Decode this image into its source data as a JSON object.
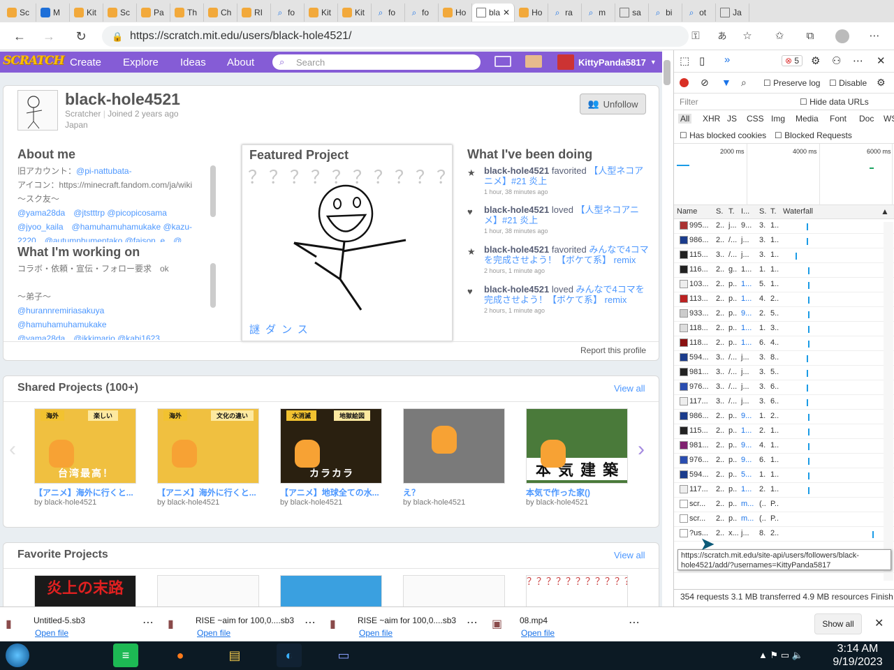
{
  "tabs": [
    {
      "fav": "scratch",
      "label": "Sc"
    },
    {
      "fav": "outlook",
      "label": "M"
    },
    {
      "fav": "scratch",
      "label": "Kit"
    },
    {
      "fav": "scratch",
      "label": "Sc"
    },
    {
      "fav": "scratch",
      "label": "Pa"
    },
    {
      "fav": "scratch",
      "label": "Th"
    },
    {
      "fav": "scratch",
      "label": "Ch"
    },
    {
      "fav": "scratch",
      "label": "RI"
    },
    {
      "fav": "search",
      "label": "fo"
    },
    {
      "fav": "scratch",
      "label": "Kit"
    },
    {
      "fav": "scratch",
      "label": "Kit"
    },
    {
      "fav": "search",
      "label": "fo"
    },
    {
      "fav": "search",
      "label": "fo"
    },
    {
      "fav": "scratch",
      "label": "Ho"
    },
    {
      "fav": "active",
      "label": "bla"
    },
    {
      "fav": "scratch",
      "label": "Ho"
    },
    {
      "fav": "search",
      "label": "ra"
    },
    {
      "fav": "search",
      "label": "m"
    },
    {
      "fav": "doc",
      "label": "sa"
    },
    {
      "fav": "search",
      "label": "bi"
    },
    {
      "fav": "search",
      "label": "ot"
    },
    {
      "fav": "doc",
      "label": "Ja"
    }
  ],
  "browser": {
    "url": "https://scratch.mit.edu/users/black-hole4521/"
  },
  "scratch_nav": {
    "logo": "SCRATCH",
    "links": [
      "Create",
      "Explore",
      "Ideas",
      "About"
    ],
    "search_placeholder": "Search",
    "username": "KittyPanda5817"
  },
  "profile": {
    "username": "black-hole4521",
    "role": "Scratcher",
    "joined": "Joined 2 years ago",
    "country": "Japan",
    "unfollow_label": "Unfollow",
    "about_heading": "About me",
    "about_lines": [
      {
        "t": "旧アカウント：",
        "l": "@pi-nattubata-"
      },
      {
        "t": "アイコン：https://minecraft.fandom.com/ja/wiki",
        "l": ""
      },
      {
        "t": "～スク友～",
        "l": ""
      },
      {
        "t": "",
        "l": "@yama28da　@jtstttrp @picopicosama"
      },
      {
        "t": "",
        "l": "@jyoo_kaila　@hamuhamuhamukake @kazu-"
      },
      {
        "t": "",
        "l": "2220　@autumnhumentako @faison_e　@"
      }
    ],
    "working_heading": "What I'm working on",
    "working_lines": [
      {
        "t": "コラボ・依頼・宣伝・フォロー要求　ok",
        "l": ""
      },
      {
        "t": "",
        "l": ""
      },
      {
        "t": "～弟子～",
        "l": ""
      },
      {
        "t": "",
        "l": "@hurannremiriasakuya"
      },
      {
        "t": "",
        "l": "@hamuhamuhamukake"
      },
      {
        "t": "",
        "l": "@yama28da　@ikkimario @kabi1623"
      }
    ],
    "featured_heading": "Featured Project",
    "featured_title": "謎ダンス",
    "activity_heading": "What I've been doing",
    "activity": [
      {
        "icon": "star",
        "user": "black-hole4521",
        "action": "favorited",
        "target": "【人型ネコアニメ】#21 炎上",
        "time": "1 hour, 38 minutes ago"
      },
      {
        "icon": "heart",
        "user": "black-hole4521",
        "action": "loved",
        "target": "【人型ネコアニメ】#21 炎上",
        "time": "1 hour, 38 minutes ago"
      },
      {
        "icon": "star",
        "user": "black-hole4521",
        "action": "favorited",
        "target": "みんなで4コマを完成させよう！【ボケて系】 remix",
        "time": "2 hours, 1 minute ago"
      },
      {
        "icon": "heart",
        "user": "black-hole4521",
        "action": "loved",
        "target": "みんなで4コマを完成させよう！【ボケて系】 remix",
        "time": "2 hours, 1 minute ago"
      }
    ],
    "report": "Report this profile"
  },
  "shared": {
    "heading": "Shared Projects (100+)",
    "view_all": "View all",
    "projects": [
      {
        "title": "【アニメ】海外に行くと...",
        "by": "by black-hole4521",
        "bg": "#f0c040",
        "labels": [
          "海外",
          "楽しい"
        ],
        "caption": "台湾最高！"
      },
      {
        "title": "【アニメ】海外に行くと...",
        "by": "by black-hole4521",
        "bg": "#f0c040",
        "labels": [
          "海外",
          "文化の違い"
        ],
        "caption": ""
      },
      {
        "title": "【アニメ】地球全ての水...",
        "by": "by black-hole4521",
        "bg": "#2a2010",
        "labels": [
          "水消滅",
          "地獄絵図"
        ],
        "caption": "カラカラ"
      },
      {
        "title": "え？",
        "by": "by black-hole4521",
        "bg": "#7a7a7a",
        "labels": [],
        "caption": ""
      },
      {
        "title": "本気で作った家()",
        "by": "by black-hole4521",
        "bg": "#4a7a3a",
        "labels": [],
        "caption": "本 気 建 築"
      }
    ]
  },
  "favorites": {
    "heading": "Favorite Projects",
    "view_all": "View all",
    "first_caption": "炎上の末路"
  },
  "devtools": {
    "error_count": "5",
    "preserve_log": "Preserve log",
    "disable": "Disable",
    "filter_placeholder": "Filter",
    "hide_data_urls": "Hide data URLs",
    "types": [
      "All",
      "XHR",
      "JS",
      "CSS",
      "Img",
      "Media",
      "Font",
      "Doc",
      "WS",
      "Manif"
    ],
    "has_blocked": "Has blocked cookies",
    "blocked_requests": "Blocked Requests",
    "timeline": [
      "2000 ms",
      "4000 ms",
      "6000 ms"
    ],
    "cols": [
      "Name",
      "S.",
      "T.",
      "I...",
      "S.",
      "T.",
      "Waterfall"
    ],
    "rows": [
      {
        "n": "995...",
        "s": "2..",
        "t": "j...",
        "i": "9...",
        "z": "3.",
        "m": "1..",
        "ic": "#a33"
      },
      {
        "n": "986...",
        "s": "2..",
        "t": "/...",
        "i": "j...",
        "z": "3.",
        "m": "1..",
        "ic": "#1b3c8c"
      },
      {
        "n": "115...",
        "s": "3..",
        "t": "/...",
        "i": "j...",
        "z": "3.",
        "m": "1..",
        "ic": "#222"
      },
      {
        "n": "116...",
        "s": "2..",
        "t": "g..",
        "i": "1...",
        "z": "1.",
        "m": "1..",
        "ic": "#222"
      },
      {
        "n": "103...",
        "s": "2..",
        "t": "p..",
        "i": "1...",
        "z": "5.",
        "m": "1..",
        "ic": "#eee"
      },
      {
        "n": "113...",
        "s": "2..",
        "t": "p..",
        "i": "1...",
        "z": "4.",
        "m": "2..",
        "ic": "#b22"
      },
      {
        "n": "933...",
        "s": "2..",
        "t": "p..",
        "i": "9...",
        "z": "2.",
        "m": "5..",
        "ic": "#ccc"
      },
      {
        "n": "118...",
        "s": "2..",
        "t": "p..",
        "i": "1...",
        "z": "1.",
        "m": "3..",
        "ic": "#ddd"
      },
      {
        "n": "118...",
        "s": "2..",
        "t": "p..",
        "i": "1...",
        "z": "6.",
        "m": "4..",
        "ic": "#8a1010"
      },
      {
        "n": "594...",
        "s": "3..",
        "t": "/...",
        "i": "j...",
        "z": "3.",
        "m": "8..",
        "ic": "#1b3c8c"
      },
      {
        "n": "981...",
        "s": "3..",
        "t": "/...",
        "i": "j...",
        "z": "3.",
        "m": "5..",
        "ic": "#222"
      },
      {
        "n": "976...",
        "s": "3..",
        "t": "/...",
        "i": "j...",
        "z": "3.",
        "m": "6..",
        "ic": "#2a4db0"
      },
      {
        "n": "117...",
        "s": "3..",
        "t": "/...",
        "i": "j...",
        "z": "3.",
        "m": "6..",
        "ic": "#eee"
      },
      {
        "n": "986...",
        "s": "2..",
        "t": "p..",
        "i": "9...",
        "z": "1.",
        "m": "2..",
        "ic": "#1b3c8c"
      },
      {
        "n": "115...",
        "s": "2..",
        "t": "p..",
        "i": "1...",
        "z": "2.",
        "m": "1..",
        "ic": "#222"
      },
      {
        "n": "981...",
        "s": "2..",
        "t": "p..",
        "i": "9...",
        "z": "4.",
        "m": "1..",
        "ic": "#802070"
      },
      {
        "n": "976...",
        "s": "2..",
        "t": "p..",
        "i": "9...",
        "z": "6.",
        "m": "1..",
        "ic": "#2a4db0"
      },
      {
        "n": "594...",
        "s": "2..",
        "t": "p..",
        "i": "5...",
        "z": "1.",
        "m": "1..",
        "ic": "#1b3c8c"
      },
      {
        "n": "117...",
        "s": "2..",
        "t": "p..",
        "i": "1...",
        "z": "2.",
        "m": "1..",
        "ic": "#eee"
      },
      {
        "n": "scr...",
        "s": "2..",
        "t": "p..",
        "i": "m...",
        "z": "(..",
        "m": "P..",
        "ic": "#fff"
      },
      {
        "n": "scr...",
        "s": "2..",
        "t": "p..",
        "i": "m...",
        "z": "(..",
        "m": "P..",
        "ic": "#fff"
      },
      {
        "n": "?us...",
        "s": "2..",
        "t": "x...",
        "i": "j...",
        "z": "8.",
        "m": "2..",
        "ic": "#fff"
      }
    ],
    "last_row": {
      "n": "coll...",
      "s": "2..",
      "t": "t...",
      "i": "js...",
      "z": "4.",
      "m": "7.."
    },
    "tooltip": "https://scratch.mit.edu/site-api/users/followers/black-hole4521/add/?usernames=KittyPanda5817",
    "status": "354 requests   3.1 MB transferred   4.9 MB resources   Finish"
  },
  "downloads": {
    "items": [
      {
        "name": "Untitled-5.sb3",
        "open": "Open file"
      },
      {
        "name": "RISE ~aim for 100,0....sb3",
        "open": "Open file"
      },
      {
        "name": "RISE ~aim for 100,0....sb3",
        "open": "Open file"
      },
      {
        "name": "08.mp4",
        "open": "Open file"
      }
    ],
    "show_all": "Show all"
  },
  "taskbar": {
    "time": "3:14 AM",
    "date": "9/19/2023"
  }
}
